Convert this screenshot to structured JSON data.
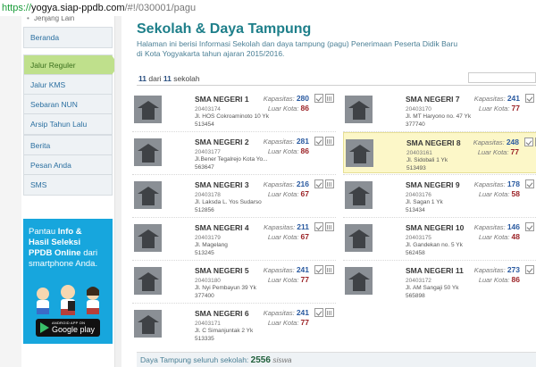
{
  "browser": {
    "url_scheme": "https://",
    "url_host": "yogya.siap-ppdb.com",
    "url_path": "/#!/030001/pagu"
  },
  "sidebar": {
    "top_item": "Jenjang Lain",
    "groups": [
      [
        "Beranda"
      ],
      [
        "Jalur Reguler",
        "Jalur KMS"
      ],
      [
        "Sebaran NUN",
        "Arsip Tahun Lalu"
      ],
      [
        "Berita",
        "Pesan Anda",
        "SMS"
      ]
    ],
    "active": "Jalur Reguler"
  },
  "ad": {
    "line1_a": "Pantau ",
    "line1_b": "Info &",
    "line2": "Hasil Seleksi",
    "line3": "PPDB Online",
    "line3_b": " dari",
    "line4": "smartphone Anda.",
    "store_small": "ANDROID APP ON",
    "store_big": "Google play"
  },
  "main": {
    "title": "Sekolah & Daya Tampung",
    "description": "Halaman ini berisi Informasi Sekolah dan daya tampung (pagu) Penerimaan Peserta Didik Baru di Kota Yogyakarta tahun ajaran 2015/2016.",
    "count_shown": "11",
    "count_of": " dari ",
    "count_total": "11",
    "count_unit": " sekolah",
    "label_kapasitas": "Kapasitas:",
    "label_luar_kota": "Luar Kota:",
    "schools_left": [
      {
        "name": "SMA NEGERI 1",
        "npsn": "20403174",
        "address": "Jl. HOS Cokroaminoto 10 Yk",
        "zip": "513454",
        "kapasitas": "280",
        "luar": "86"
      },
      {
        "name": "SMA NEGERI 2",
        "npsn": "20403177",
        "address": "Jl.Bener Tegalrejo Kota Yo...",
        "zip": "563647",
        "kapasitas": "281",
        "luar": "86"
      },
      {
        "name": "SMA NEGERI 3",
        "npsn": "20403178",
        "address": "Jl. Laksda L. Yos Sudarso",
        "zip": "512856",
        "kapasitas": "216",
        "luar": "67"
      },
      {
        "name": "SMA NEGERI 4",
        "npsn": "20403179",
        "address": "Jl. Magelang",
        "zip": "513245",
        "kapasitas": "211",
        "luar": "67"
      },
      {
        "name": "SMA NEGERI 5",
        "npsn": "20403180",
        "address": "Jl. Nyi Pembayun 39 Yk",
        "zip": "377400",
        "kapasitas": "241",
        "luar": "77"
      },
      {
        "name": "SMA NEGERI 6",
        "npsn": "20403171",
        "address": "Jl. C Simanjuntak 2 Yk",
        "zip": "513335",
        "kapasitas": "241",
        "luar": "77"
      }
    ],
    "schools_right": [
      {
        "name": "SMA NEGERI 7",
        "npsn": "20403170",
        "address": "Jl. MT Haryono no. 47 Yk",
        "zip": "377740",
        "kapasitas": "241",
        "luar": "77"
      },
      {
        "name": "SMA NEGERI 8",
        "npsn": "20403161",
        "address": "Jl. Sidobali 1 Yk",
        "zip": "513493",
        "kapasitas": "248",
        "luar": "77"
      },
      {
        "name": "SMA NEGERI 9",
        "npsn": "20403176",
        "address": "Jl. Sagan 1 Yk",
        "zip": "513434",
        "kapasitas": "178",
        "luar": "58"
      },
      {
        "name": "SMA NEGERI 10",
        "npsn": "20403175",
        "address": "Jl. Gandekan no. 5 Yk",
        "zip": "562458",
        "kapasitas": "146",
        "luar": "48"
      },
      {
        "name": "SMA NEGERI 11",
        "npsn": "20403172",
        "address": "Jl. AM Sangaji 50 Yk",
        "zip": "565898",
        "kapasitas": "273",
        "luar": "86"
      }
    ],
    "highlighted": "SMA NEGERI 8",
    "footer_label": "Daya Tampung seluruh sekolah: ",
    "footer_total": "2556",
    "footer_unit": " siswa"
  }
}
